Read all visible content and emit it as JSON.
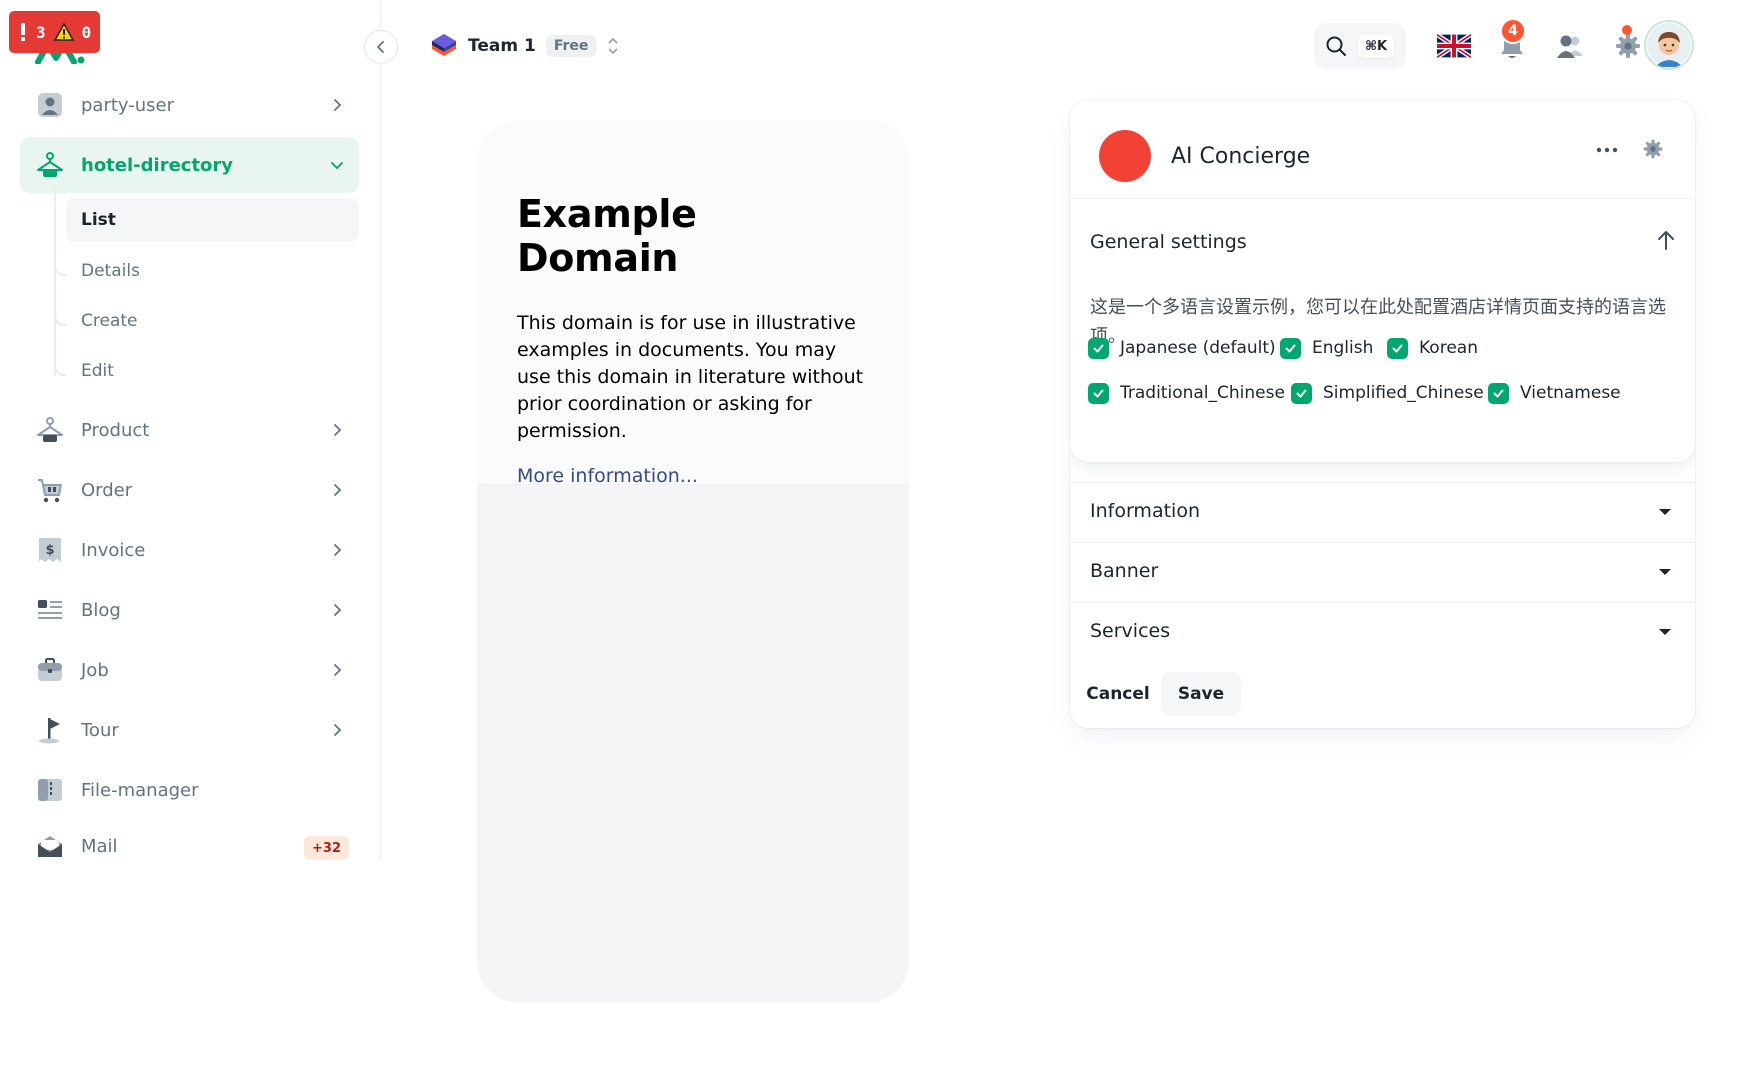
{
  "error_badge": {
    "errors": "3",
    "warnings": "0"
  },
  "sidebar": {
    "items": [
      {
        "label": "party-user",
        "icon": "user-icon"
      },
      {
        "label": "hotel-directory",
        "icon": "hanger-icon",
        "active": true
      },
      {
        "label": "Product",
        "icon": "hanger-icon"
      },
      {
        "label": "Order",
        "icon": "cart-icon"
      },
      {
        "label": "Invoice",
        "icon": "invoice-icon"
      },
      {
        "label": "Blog",
        "icon": "blog-icon"
      },
      {
        "label": "Job",
        "icon": "briefcase-icon"
      },
      {
        "label": "Tour",
        "icon": "flag-icon"
      },
      {
        "label": "File-manager",
        "icon": "folder-icon"
      },
      {
        "label": "Mail",
        "icon": "mail-icon",
        "badge": "+32"
      }
    ],
    "subitems": [
      {
        "label": "List",
        "active": true
      },
      {
        "label": "Details"
      },
      {
        "label": "Create"
      },
      {
        "label": "Edit"
      }
    ]
  },
  "header": {
    "team_name": "Team 1",
    "plan_badge": "Free",
    "search_shortcut": "⌘K",
    "notification_count": "4",
    "language_flag": "uk-flag-icon"
  },
  "preview": {
    "title": "Example Domain",
    "body": "This domain is for use in illustrative examples in documents. You may use this domain in literature without prior coordination or asking for permission.",
    "link": "More information..."
  },
  "panel": {
    "title": "AI Concierge",
    "section_title": "General settings",
    "description": "这是一个多语言设置示例，您可以在此处配置酒店详情页面支持的语言选项。",
    "languages": [
      {
        "label": "Japanese (default)",
        "checked": true
      },
      {
        "label": "English",
        "checked": true
      },
      {
        "label": "Korean",
        "checked": true
      },
      {
        "label": "Traditional_Chinese",
        "checked": true
      },
      {
        "label": "Simplified_Chinese",
        "checked": true
      },
      {
        "label": "Vietnamese",
        "checked": true
      }
    ],
    "accordions": [
      "Information",
      "Banner",
      "Services"
    ],
    "cancel_label": "Cancel",
    "save_label": "Save"
  },
  "colors": {
    "accent": "#00a76f",
    "ai_dot": "#f24236",
    "error": "#e53935"
  }
}
